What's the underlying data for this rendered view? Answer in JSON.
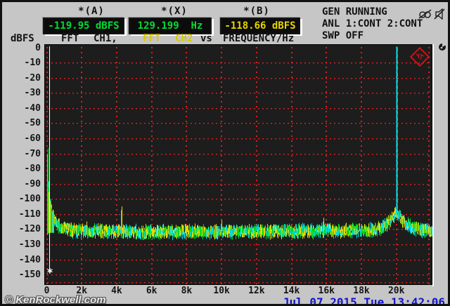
{
  "header": {
    "cursor_a": {
      "label": "*(A)",
      "value": "-119.95 dBFS",
      "color": "#00dd33"
    },
    "cursor_x": {
      "label": "*(X)",
      "value": "129.199  Hz",
      "color": "#00dd33"
    },
    "cursor_b": {
      "label": "*(B)",
      "value": "-118.66 dBFS",
      "color": "#e6d400"
    },
    "status": {
      "line1": "GEN RUNNING",
      "line2": "ANL 1:CONT 2:CONT",
      "line3": "SWP OFF"
    },
    "icons": [
      "binoculars-muted-icon",
      "speaker-muted-icon",
      "busy-indicator-icon",
      "rs-diamond-logo"
    ],
    "trace_row": {
      "y_unit": "dBFS",
      "ch1_func": "FFT",
      "ch1_name": "CH1,",
      "ch2_func": "FFT",
      "ch2_name": "CH2",
      "vs": "vs",
      "x_axis": "FREQUENCY/Hz"
    }
  },
  "footer": {
    "watermark": "© KenRockwell.com",
    "datetime": "Jul 07 2015 Tue 13:42:06"
  },
  "chart_data": {
    "type": "line",
    "title": "FFT CH1, FFT CH2 vs FREQUENCY/Hz",
    "xlabel": "FREQUENCY/Hz",
    "ylabel": "dBFS",
    "xlim": [
      0,
      22000
    ],
    "ylim": [
      -157,
      0
    ],
    "grid": "red-dotted, 2 kHz x-steps, 10 dB y-steps",
    "legend_position": "header-row",
    "x_ticks": [
      {
        "f": 0,
        "label": "0"
      },
      {
        "f": 2000,
        "label": "2k"
      },
      {
        "f": 4000,
        "label": "4k"
      },
      {
        "f": 6000,
        "label": "6k"
      },
      {
        "f": 8000,
        "label": "8k"
      },
      {
        "f": 10000,
        "label": "10k"
      },
      {
        "f": 12000,
        "label": "12k"
      },
      {
        "f": 14000,
        "label": "14k"
      },
      {
        "f": 16000,
        "label": "16k"
      },
      {
        "f": 18000,
        "label": "18k"
      },
      {
        "f": 20000,
        "label": "20k"
      }
    ],
    "y_ticks": [
      {
        "db": 0,
        "label": "0"
      },
      {
        "db": -10,
        "label": "-10"
      },
      {
        "db": -20,
        "label": "-20"
      },
      {
        "db": -30,
        "label": "-30"
      },
      {
        "db": -40,
        "label": "-40"
      },
      {
        "db": -50,
        "label": "-50"
      },
      {
        "db": -60,
        "label": "-60"
      },
      {
        "db": -70,
        "label": "-70"
      },
      {
        "db": -80,
        "label": "-80"
      },
      {
        "db": -90,
        "label": "-90"
      },
      {
        "db": -100,
        "label": "-100"
      },
      {
        "db": -110,
        "label": "-110"
      },
      {
        "db": -120,
        "label": "-120"
      },
      {
        "db": -130,
        "label": "-130"
      },
      {
        "db": -140,
        "label": "-140"
      },
      {
        "db": -150,
        "label": "-150"
      }
    ],
    "series": [
      {
        "name": "FFT CH1",
        "color": "#00dce0"
      },
      {
        "name": "FFT CH2",
        "color": "#e2da00"
      },
      {
        "name": "ch1+ch2 overlap",
        "color": "#00d81e"
      }
    ],
    "noise_floor_db": -121,
    "noise_jitter_db": 3.2,
    "floor_envelope": [
      [
        0,
        -70
      ],
      [
        40,
        -80
      ],
      [
        80,
        -90
      ],
      [
        130,
        -97
      ],
      [
        200,
        -103
      ],
      [
        300,
        -109
      ],
      [
        450,
        -114
      ],
      [
        650,
        -117
      ],
      [
        900,
        -119
      ],
      [
        1400,
        -120.5
      ],
      [
        2500,
        -121
      ],
      [
        6000,
        -121.5
      ],
      [
        12000,
        -121
      ],
      [
        18500,
        -120.5
      ],
      [
        19200,
        -118
      ],
      [
        19600,
        -114.5
      ],
      [
        19850,
        -111
      ],
      [
        20000,
        -108
      ],
      [
        20150,
        -111
      ],
      [
        20400,
        -114.5
      ],
      [
        20800,
        -118
      ],
      [
        21300,
        -120
      ],
      [
        22100,
        -121
      ]
    ],
    "spikes": [
      {
        "f": 4250,
        "db": -107
      },
      {
        "f": 2250,
        "db": -117
      },
      {
        "f": 9950,
        "db": -116
      },
      {
        "f": 15800,
        "db": -114.5
      }
    ],
    "tone": {
      "f": 20000,
      "db": 0
    },
    "left_spike": {
      "f": 30,
      "db": -70
    },
    "cursor": {
      "f": 129.199,
      "marker": "*",
      "marker_db": -146,
      "a_db": -119.95,
      "b_db": -118.66,
      "color": "#ffffff"
    }
  }
}
